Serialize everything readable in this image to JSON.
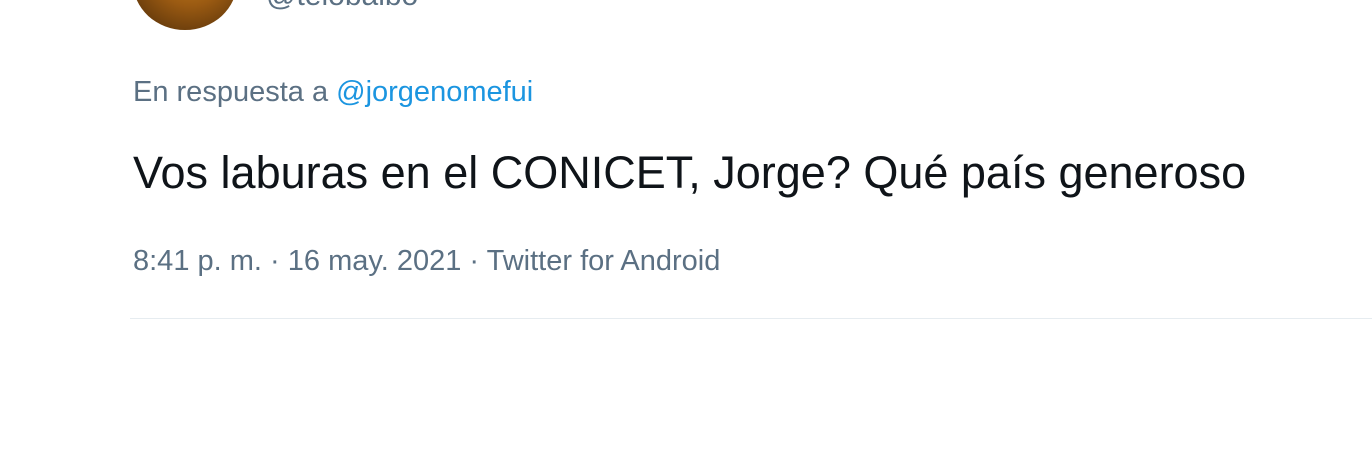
{
  "author": {
    "handle": "@telobalbo"
  },
  "tweet": {
    "reply_prefix": "En respuesta a",
    "reply_to": "@jorgenomefui",
    "text": "Vos laburas en el CONICET, Jorge? Qué país generoso",
    "time": "8:41 p. m.",
    "separator": "·",
    "date": "16 may. 2021",
    "source": "Twitter for Android"
  },
  "colors": {
    "text": "#0f1419",
    "secondary": "#5b7083",
    "link": "#1b95e0",
    "divider": "#e6ecf0"
  }
}
